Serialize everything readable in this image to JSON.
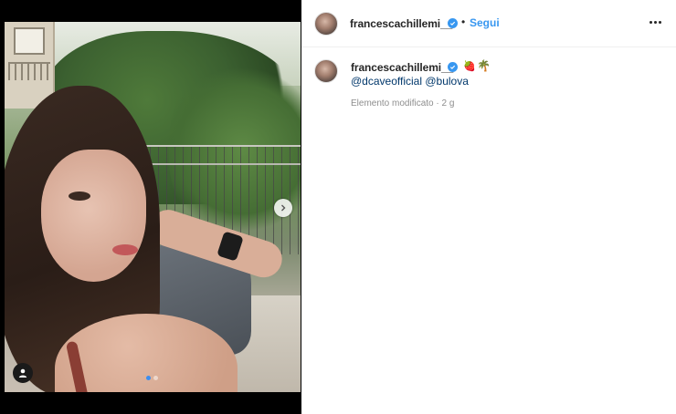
{
  "post": {
    "username": "francescachillemi__",
    "verified": true,
    "follow_label": "Segui",
    "dot_separator": "•",
    "more_icon": "more-horizontal-icon",
    "caption": {
      "emoji_1": "🍓",
      "emoji_2": "🌴",
      "mention_1": "@dcaveofficial",
      "mention_2": "@bulova"
    },
    "edited_label": "Elemento modificato",
    "time_separator": "·",
    "age": "2 g",
    "carousel": {
      "slide_count": 2,
      "active_index": 0
    }
  },
  "colors": {
    "accent": "#3897f0",
    "text": "#262626",
    "muted": "#8e8e8e",
    "mention": "#00376b"
  }
}
